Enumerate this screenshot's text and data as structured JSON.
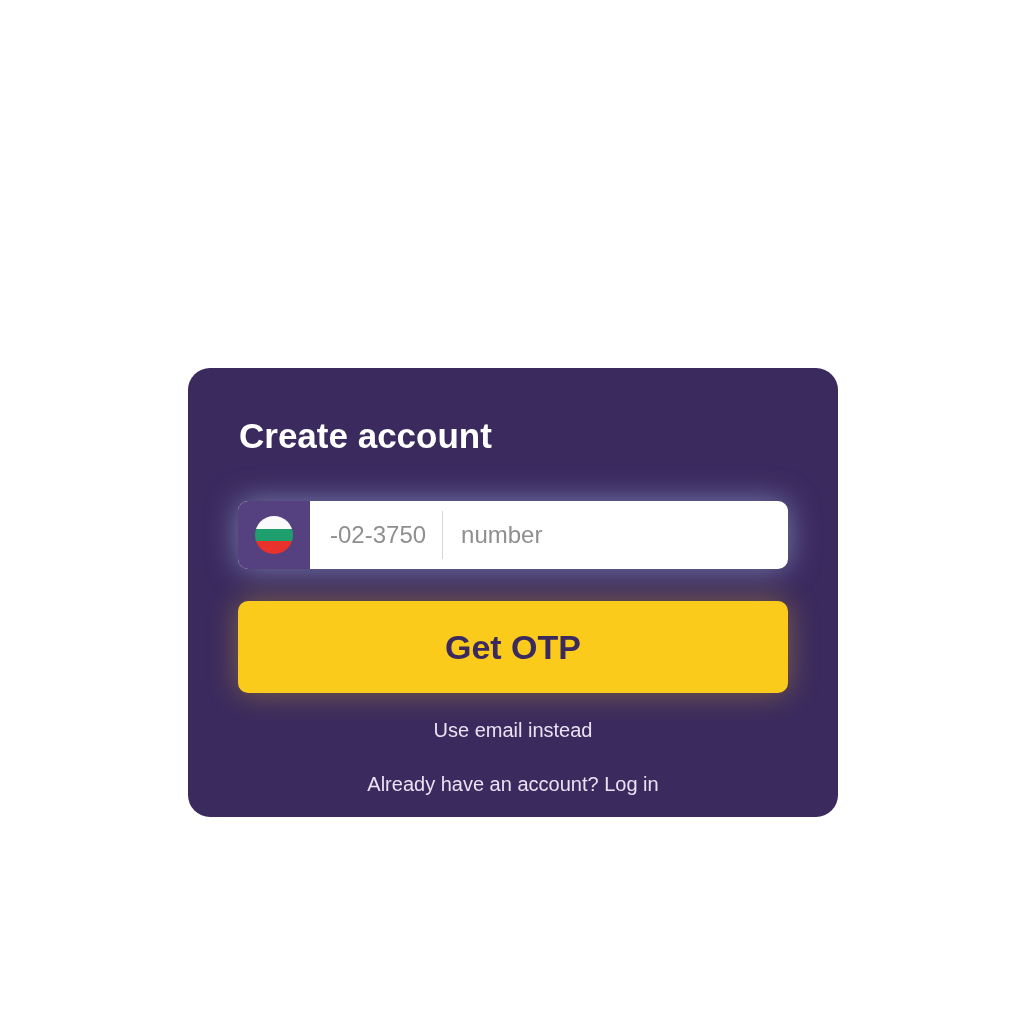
{
  "card": {
    "title": "Create account",
    "phone_field": {
      "prefix": "-02-3750",
      "placeholder": "number"
    },
    "submit_button": {
      "label": "Get OTP"
    },
    "alt_link": {
      "label": "Use email instead"
    },
    "login_prompt": {
      "text": "Already have an account? Log in"
    }
  }
}
